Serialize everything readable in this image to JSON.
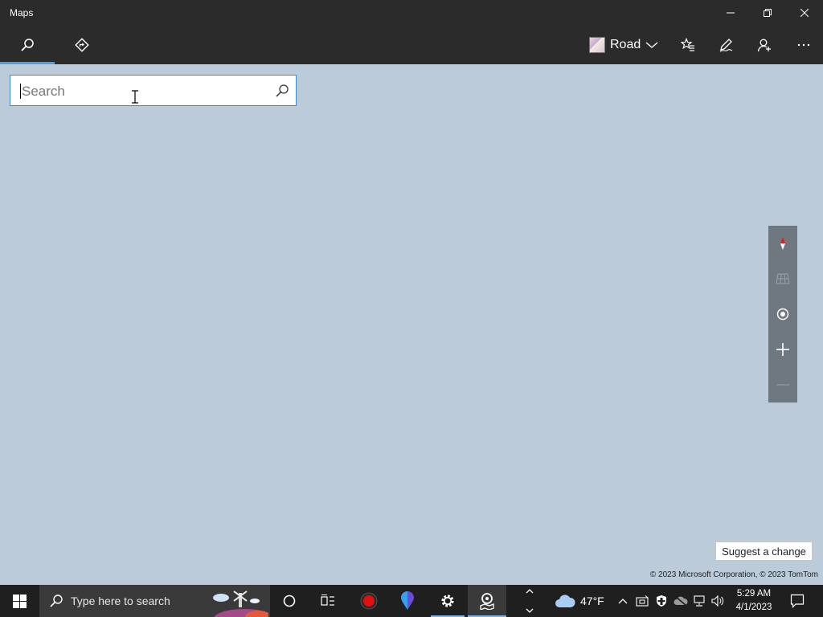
{
  "window": {
    "title": "Maps"
  },
  "toolbar": {
    "map_style_label": "Road"
  },
  "search": {
    "placeholder": "Search"
  },
  "map": {
    "suggest_label": "Suggest a change",
    "copyright": "© 2023 Microsoft Corporation, © 2023 TomTom"
  },
  "taskbar": {
    "search_placeholder": "Type here to search",
    "weather_temp": "47°F",
    "time": "5:29 AM",
    "date": "4/1/2023"
  },
  "colors": {
    "titlebar": "#2b2b2b",
    "map_bg": "#bccbd9",
    "accent": "#4aa0e6",
    "taskbar": "#1f1f1f"
  }
}
